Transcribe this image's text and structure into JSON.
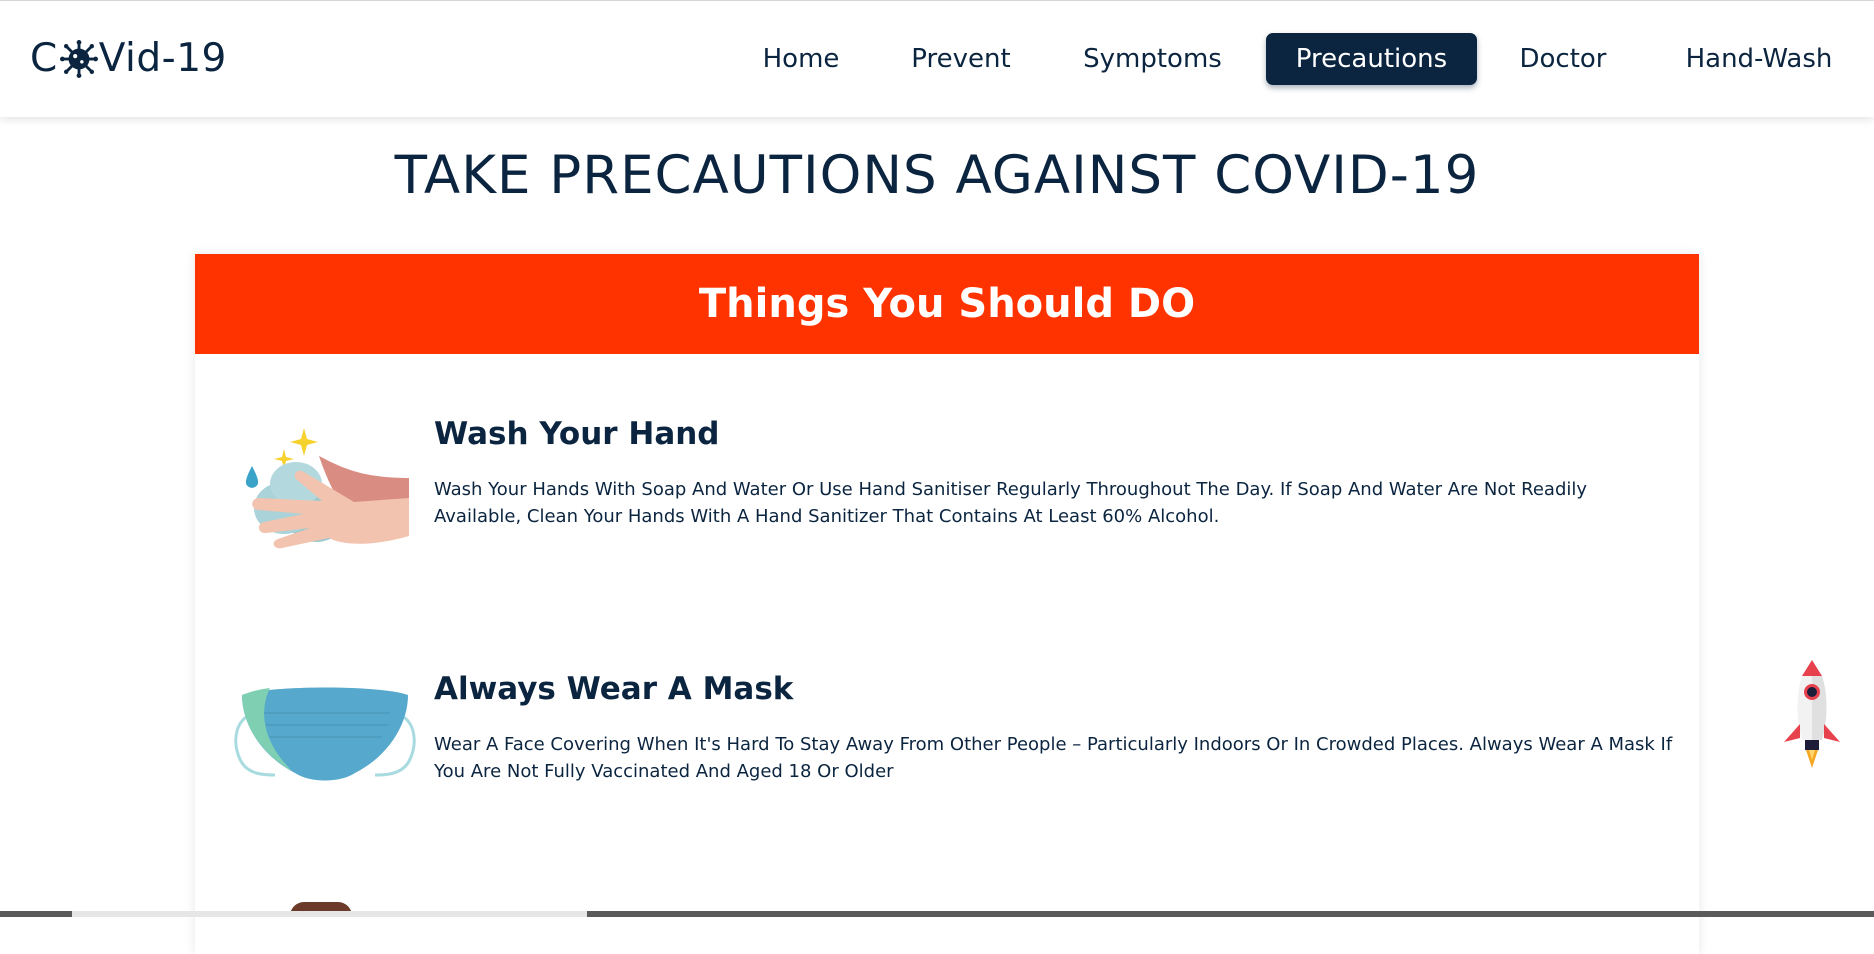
{
  "brand": {
    "prefix": "C",
    "suffix": "Vid-19",
    "icon": "virus-icon"
  },
  "nav": {
    "items": [
      {
        "label": "Home"
      },
      {
        "label": "Prevent"
      },
      {
        "label": "Symptoms"
      },
      {
        "label": "Precautions",
        "active": true
      },
      {
        "label": "Doctor"
      },
      {
        "label": "Hand-Wash"
      }
    ]
  },
  "page": {
    "title": "TAKE PRECAUTIONS AGAINST COVID-19"
  },
  "card": {
    "header": "Things You Should DO",
    "items": [
      {
        "icon": "hand-wash-icon",
        "title": "Wash Your Hand",
        "text": "Wash Your Hands With Soap And Water Or Use Hand Sanitiser Regularly Throughout The Day. If Soap And Water Are Not Readily Available, Clean Your Hands With A Hand Sanitizer That Contains At Least 60% Alcohol."
      },
      {
        "icon": "face-mask-icon",
        "title": "Always Wear A Mask",
        "text": "Wear A Face Covering When It's Hard To Stay Away From Other People – Particularly Indoors Or In Crowded Places. Always Wear A Mask If You Are Not Fully Vaccinated And Aged 18 Or Older"
      }
    ]
  },
  "scroll_top": {
    "icon": "rocket-icon"
  },
  "colors": {
    "primary": "#0b2540",
    "accent": "#ff3300",
    "mask": "#56a9cc"
  }
}
